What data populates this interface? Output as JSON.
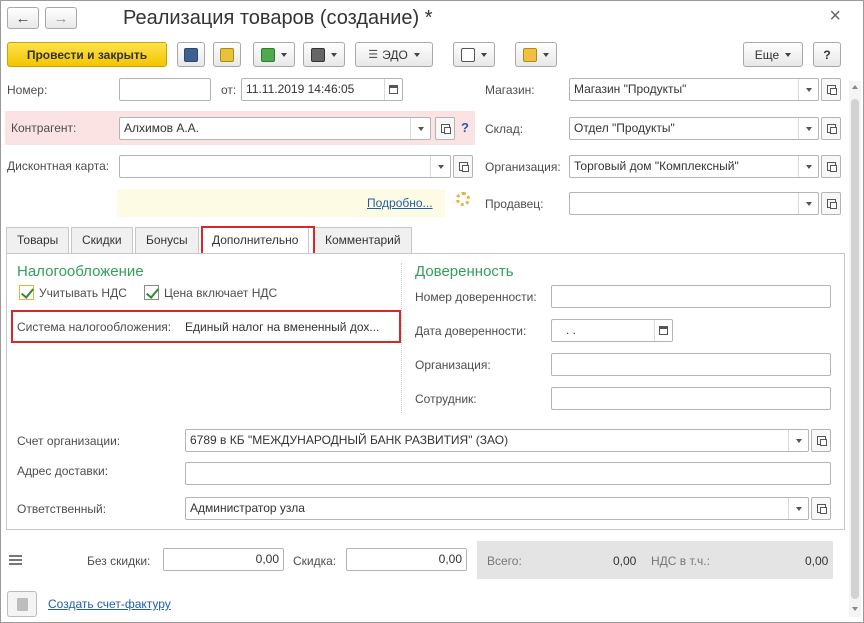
{
  "window": {
    "title": "Реализация товаров (создание) *",
    "close": "×"
  },
  "toolbar": {
    "post_close": "Провести и закрыть",
    "edo": "ЭДО",
    "more": "Еще",
    "help": "?"
  },
  "header": {
    "number_label": "Номер:",
    "number_value": "",
    "date_label": "от:",
    "date_value": "11.11.2019 14:46:05",
    "counterparty_label": "Контрагент:",
    "counterparty_value": "Алхимов А.А.",
    "counterparty_help": "?",
    "discount_card_label": "Дисконтная карта:",
    "discount_card_value": "",
    "details_link": "Подробно...",
    "store_label": "Магазин:",
    "store_value": "Магазин \"Продукты\"",
    "warehouse_label": "Склад:",
    "warehouse_value": "Отдел \"Продукты\"",
    "org_label": "Организация:",
    "org_value": "Торговый дом \"Комплексный\"",
    "seller_label": "Продавец:",
    "seller_value": ""
  },
  "tabs": [
    {
      "label": "Товары"
    },
    {
      "label": "Скидки"
    },
    {
      "label": "Бонусы"
    },
    {
      "label": "Дополнительно"
    },
    {
      "label": "Комментарий"
    }
  ],
  "taxation": {
    "title": "Налогообложение",
    "vat_label": "Учитывать НДС",
    "price_incl_vat_label": "Цена включает НДС",
    "system_label": "Система налогообложения:",
    "system_value": "Единый налог на вмененный дох..."
  },
  "power_of_attorney": {
    "title": "Доверенность",
    "number_label": "Номер доверенности:",
    "date_label": "Дата доверенности:",
    "date_value": " .  .",
    "org_label": "Организация:",
    "employee_label": "Сотрудник:"
  },
  "bottom_fields": {
    "account_label": "Счет организации:",
    "account_value": "6789 в КБ \"МЕЖДУНАРОДНЫЙ БАНК РАЗВИТИЯ\" (ЗАО)",
    "address_label": "Адрес доставки:",
    "address_value": "",
    "responsible_label": "Ответственный:",
    "responsible_value": "Администратор узла"
  },
  "totals": {
    "no_discount_label": "Без скидки:",
    "no_discount_value": "0,00",
    "discount_label": "Скидка:",
    "discount_value": "0,00",
    "total_label": "Всего:",
    "total_value": "0,00",
    "vat_label": "НДС в т.ч.:",
    "vat_value": "0,00"
  },
  "footer": {
    "invoice_link": "Создать счет-фактуру"
  }
}
